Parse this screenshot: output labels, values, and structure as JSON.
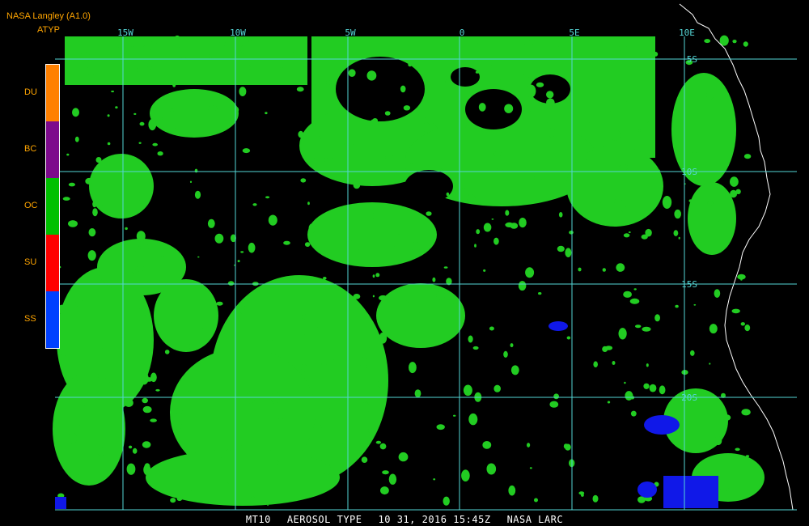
{
  "header": {
    "org": "NASA Langley (A1.0)",
    "product": "ATYP"
  },
  "legend": [
    {
      "label": "DU",
      "color": "#ff8000"
    },
    {
      "label": "BC",
      "color": "#7d0a8c"
    },
    {
      "label": "OC",
      "color": "#00c000"
    },
    {
      "label": "SU",
      "color": "#ff0000"
    },
    {
      "label": "SS",
      "color": "#0040ff"
    }
  ],
  "grid": {
    "color": "#55d6d6",
    "longitudes": [
      "15W",
      "10W",
      "5W",
      "0",
      "5E",
      "10E"
    ],
    "latitudes": [
      "5S",
      "10S",
      "15S",
      "20S"
    ]
  },
  "colors": {
    "oc": "#22cc22",
    "ss": "#1018e8",
    "coast": "#ffffff",
    "background": "#000000"
  },
  "footer": {
    "satellite": "MT10",
    "product": "AEROSOL TYPE",
    "datetime": "10 31, 2016 15:45Z",
    "source": "NASA LARC"
  }
}
